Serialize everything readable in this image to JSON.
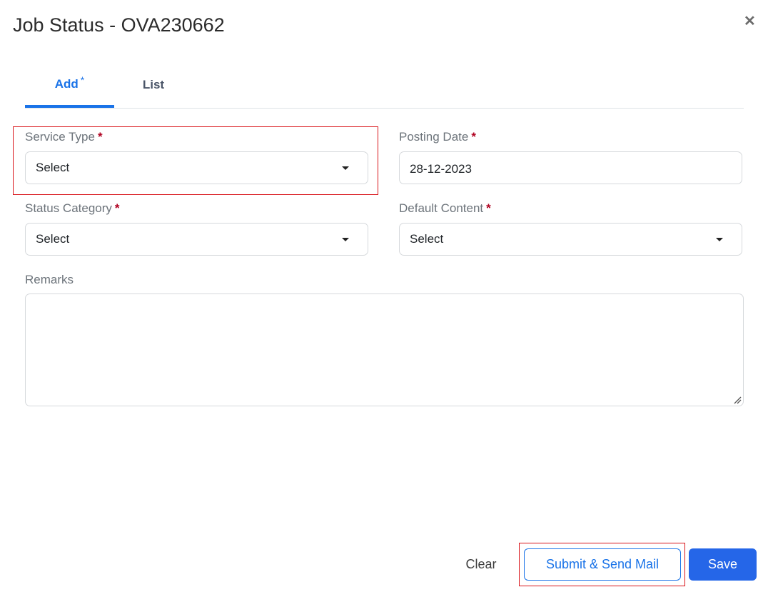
{
  "dialog": {
    "title": "Job Status - OVA230662",
    "close_icon": "close-icon"
  },
  "tabs": [
    {
      "label": "Add",
      "marker": "*",
      "active": true
    },
    {
      "label": "List",
      "active": false
    }
  ],
  "form": {
    "service_type": {
      "label": "Service Type",
      "required": "*",
      "value": "Select"
    },
    "posting_date": {
      "label": "Posting Date",
      "required": "*",
      "value": "28-12-2023"
    },
    "status_category": {
      "label": "Status Category",
      "required": "*",
      "value": "Select"
    },
    "default_content": {
      "label": "Default Content",
      "required": "*",
      "value": "Select"
    },
    "remarks": {
      "label": "Remarks",
      "value": ""
    }
  },
  "footer": {
    "clear_label": "Clear",
    "submit_label": "Submit & Send Mail",
    "save_label": "Save"
  },
  "colors": {
    "accent": "#1a73e8",
    "primary_button": "#2566e8",
    "required": "#b00020",
    "highlight": "#d9161b"
  }
}
